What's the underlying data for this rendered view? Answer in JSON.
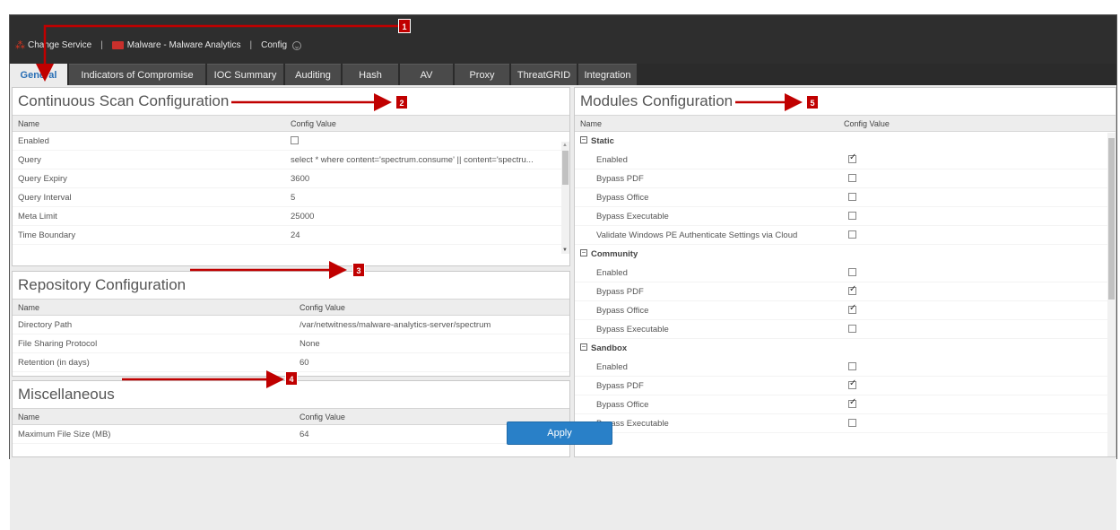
{
  "service_bar": {
    "change_service": "Change Service",
    "service_name": "Malware - Malware Analytics",
    "config": "Config"
  },
  "tabs": [
    {
      "label": "General",
      "active": true
    },
    {
      "label": "Indicators of Compromise"
    },
    {
      "label": "IOC Summary"
    },
    {
      "label": "Auditing"
    },
    {
      "label": "Hash"
    },
    {
      "label": "AV"
    },
    {
      "label": "Proxy"
    },
    {
      "label": "ThreatGRID"
    },
    {
      "label": "Integration"
    }
  ],
  "continuous_scan": {
    "title": "Continuous Scan Configuration",
    "col_name": "Name",
    "col_value": "Config Value",
    "rows": [
      {
        "name": "Enabled",
        "value": ""
      },
      {
        "name": "Query",
        "value": "select * where content='spectrum.consume' || content='spectru..."
      },
      {
        "name": "Query Expiry",
        "value": "3600"
      },
      {
        "name": "Query Interval",
        "value": "5"
      },
      {
        "name": "Meta Limit",
        "value": "25000"
      },
      {
        "name": "Time Boundary",
        "value": "24"
      }
    ]
  },
  "repository": {
    "title": "Repository Configuration",
    "col_name": "Name",
    "col_value": "Config Value",
    "rows": [
      {
        "name": "Directory Path",
        "value": "/var/netwitness/malware-analytics-server/spectrum"
      },
      {
        "name": "File Sharing Protocol",
        "value": "None"
      },
      {
        "name": "Retention (in days)",
        "value": "60"
      }
    ]
  },
  "misc": {
    "title": "Miscellaneous",
    "col_name": "Name",
    "col_value": "Config Value",
    "rows": [
      {
        "name": "Maximum File Size (MB)",
        "value": "64"
      }
    ]
  },
  "modules": {
    "title": "Modules Configuration",
    "col_name": "Name",
    "col_value": "Config Value",
    "groups": [
      {
        "label": "Static",
        "rows": [
          {
            "name": "Enabled",
            "checked": true
          },
          {
            "name": "Bypass PDF",
            "checked": false
          },
          {
            "name": "Bypass Office",
            "checked": false
          },
          {
            "name": "Bypass Executable",
            "checked": false
          },
          {
            "name": "Validate Windows PE Authenticate Settings via Cloud",
            "checked": false
          }
        ]
      },
      {
        "label": "Community",
        "rows": [
          {
            "name": "Enabled",
            "checked": false
          },
          {
            "name": "Bypass PDF",
            "checked": true
          },
          {
            "name": "Bypass Office",
            "checked": true
          },
          {
            "name": "Bypass Executable",
            "checked": false
          }
        ]
      },
      {
        "label": "Sandbox",
        "rows": [
          {
            "name": "Enabled",
            "checked": false
          },
          {
            "name": "Bypass PDF",
            "checked": true
          },
          {
            "name": "Bypass Office",
            "checked": true
          },
          {
            "name": "Bypass Executable",
            "checked": false
          }
        ]
      }
    ]
  },
  "apply_label": "Apply",
  "callouts": [
    "1",
    "2",
    "3",
    "4",
    "5"
  ],
  "colors": {
    "callout": "#c00000",
    "apply": "#2980c8",
    "tab_active_text": "#2a6fb5"
  }
}
